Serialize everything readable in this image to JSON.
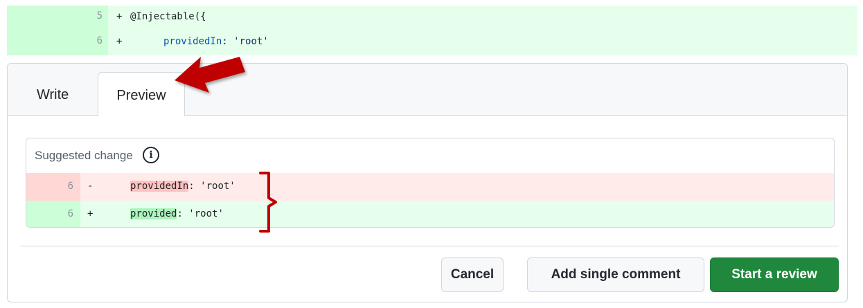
{
  "diff_top": {
    "lines": [
      {
        "number": "5",
        "sign": "+",
        "code": "@Injectable({"
      },
      {
        "number": "6",
        "sign": "+",
        "key": "providedIn",
        "rest": ": 'root'"
      }
    ]
  },
  "tabs": {
    "write_label": "Write",
    "preview_label": "Preview",
    "active": "Preview"
  },
  "suggested_change": {
    "title": "Suggested change",
    "info_icon_glyph": "i",
    "removed": {
      "number": "6",
      "sign": "-",
      "key": "providedIn",
      "rest": ": 'root'"
    },
    "added": {
      "number": "6",
      "sign": "+",
      "key": "provided",
      "rest": ": 'root'"
    }
  },
  "actions": {
    "cancel_label": "Cancel",
    "add_single_label": "Add single comment",
    "start_review_label": "Start a review"
  },
  "colors": {
    "annotation_red": "#c00000",
    "primary_green": "#1f883d",
    "added_bg": "#e6ffec",
    "removed_bg": "#ffebe9"
  },
  "icons": {
    "info": "info-circle-icon",
    "arrow": "red-arrow-annotation-icon",
    "bracket": "red-bracket-annotation-icon"
  }
}
